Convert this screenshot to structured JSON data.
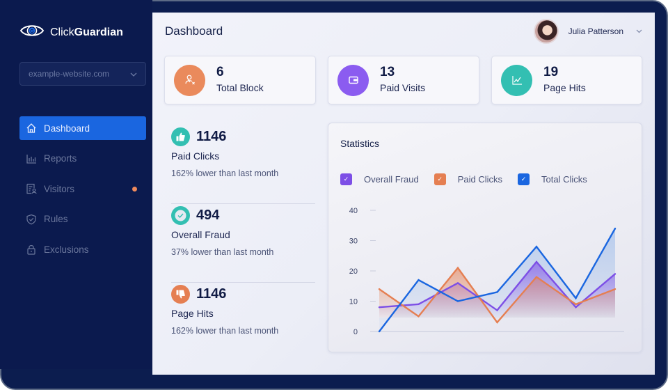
{
  "app": {
    "brand_regular": "Click",
    "brand_bold": "Guardian",
    "logo_icon": "eye-g-icon"
  },
  "sidebar": {
    "site_select": {
      "value": "example-website.com",
      "icon": "chevron-down-icon"
    },
    "items": [
      {
        "label": "Dashboard",
        "icon": "home-icon",
        "active": true
      },
      {
        "label": "Reports",
        "icon": "bar-chart-icon",
        "active": false
      },
      {
        "label": "Visitors",
        "icon": "visitor-list-icon",
        "active": false,
        "badge_dot": true
      },
      {
        "label": "Rules",
        "icon": "shield-check-icon",
        "active": false
      },
      {
        "label": "Exclusions",
        "icon": "lock-icon",
        "active": false
      }
    ]
  },
  "header": {
    "title": "Dashboard",
    "user_name": "Julia Patterson",
    "user_menu_icon": "chevron-down-icon"
  },
  "stat_cards": [
    {
      "value": "6",
      "label": "Total Block",
      "icon": "user-block-icon",
      "color": "#ea8a5c"
    },
    {
      "value": "13",
      "label": "Paid Visits",
      "icon": "wallet-icon",
      "color": "#8b5cf0"
    },
    {
      "value": "19",
      "label": "Page Hits",
      "icon": "line-chart-icon",
      "color": "#33bfb2"
    }
  ],
  "metrics": [
    {
      "value": "1146",
      "label": "Paid Clicks",
      "note": "162% lower than last month",
      "icon": "thumbs-up-icon",
      "color": "#33bfb2"
    },
    {
      "value": "494",
      "label": "Overall Fraud",
      "note": "37% lower than last month",
      "icon": "check-circle-icon",
      "color": "#33bfb2"
    },
    {
      "value": "1146",
      "label": "Page Hits",
      "note": "162% lower than last month",
      "icon": "thumbs-down-icon",
      "color": "#e57f52"
    }
  ],
  "statistics": {
    "title": "Statistics",
    "legend": [
      {
        "label": "Overall Fraud",
        "color": "#7d4fe6",
        "checked": true
      },
      {
        "label": "Paid Clicks",
        "color": "#e57f52",
        "checked": true
      },
      {
        "label": "Total Clicks",
        "color": "#1a66e0",
        "checked": true
      }
    ]
  },
  "chart_data": {
    "type": "area",
    "title": "Statistics",
    "xlabel": "",
    "ylabel": "",
    "x": [
      1,
      2,
      3,
      4,
      5,
      6,
      7
    ],
    "ylim": [
      0,
      40
    ],
    "yticks": [
      0,
      10,
      20,
      30,
      40
    ],
    "grid": false,
    "legend_position": "top-left",
    "series": [
      {
        "name": "Overall Fraud",
        "color": "#7d4fe6",
        "values": [
          8,
          9,
          16,
          7,
          23,
          8,
          19
        ]
      },
      {
        "name": "Paid Clicks",
        "color": "#e57f52",
        "values": [
          14,
          5,
          21,
          3,
          18,
          9,
          14
        ]
      },
      {
        "name": "Total Clicks",
        "color": "#1a66e0",
        "values": [
          0,
          17,
          10,
          13,
          28,
          11,
          34
        ]
      }
    ]
  }
}
